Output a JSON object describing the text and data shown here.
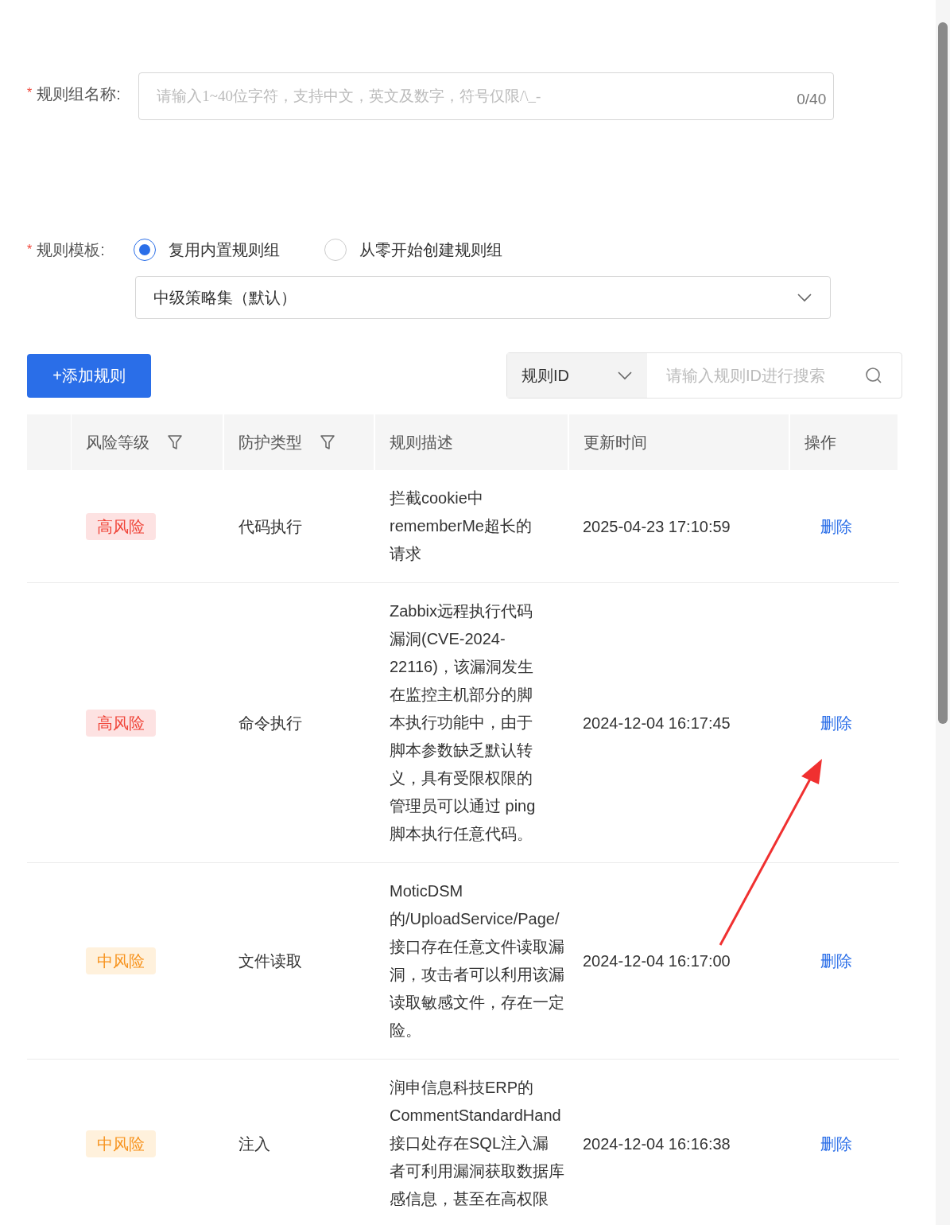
{
  "name_field": {
    "label": "规则组名称:",
    "required_mark": "*",
    "placeholder": "请输入1~40位字符，支持中文，英文及数字，符号仅限/\\_-",
    "counter": "0/40"
  },
  "template": {
    "label": "规则模板:",
    "required_mark": "*",
    "options": [
      {
        "label": "复用内置规则组",
        "selected": true
      },
      {
        "label": "从零开始创建规则组",
        "selected": false
      }
    ],
    "select_value": "中级策略集（默认）"
  },
  "add_button": "+添加规则",
  "search": {
    "field_select": "规则ID",
    "placeholder": "请输入规则ID进行搜索"
  },
  "table": {
    "columns": [
      {
        "label": "风险等级",
        "filter": true
      },
      {
        "label": "防护类型",
        "filter": true
      },
      {
        "label": "规则描述",
        "filter": false
      },
      {
        "label": "更新时间",
        "filter": false
      },
      {
        "label": "操作",
        "filter": false
      }
    ],
    "rows": [
      {
        "risk": "高风险",
        "kind": "high",
        "type": "代码执行",
        "description": [
          "拦截cookie中",
          "rememberMe超长的",
          "请求"
        ],
        "updated": "2025-04-23 17:10:59",
        "action": "删除"
      },
      {
        "risk": "高风险",
        "kind": "high",
        "type": "命令执行",
        "description": [
          "Zabbix远程执行代码",
          "漏洞(CVE-2024-",
          "22116)，该漏洞发生",
          "在监控主机部分的脚",
          "本执行功能中，由于",
          "脚本参数缺乏默认转",
          "义，具有受限权限的",
          "管理员可以通过 ping",
          "脚本执行任意代码。"
        ],
        "updated": "2024-12-04 16:17:45",
        "action": "删除"
      },
      {
        "risk": "中风险",
        "kind": "medium",
        "type": "文件读取",
        "description": [
          "MoticDSM",
          "的/UploadService/Page/",
          "接口存在任意文件读取漏",
          "洞，攻击者可以利用该漏",
          "读取敏感文件，存在一定",
          "险。"
        ],
        "updated": "2024-12-04 16:17:00",
        "action": "删除"
      },
      {
        "risk": "中风险",
        "kind": "medium",
        "type": "注入",
        "description": [
          "润申信息科技ERP的",
          "CommentStandardHand",
          "接口处存在SQL注入漏",
          "者可利用漏洞获取数据库",
          "感信息，甚至在高权限"
        ],
        "updated": "2024-12-04 16:16:38",
        "action": "删除"
      }
    ]
  }
}
